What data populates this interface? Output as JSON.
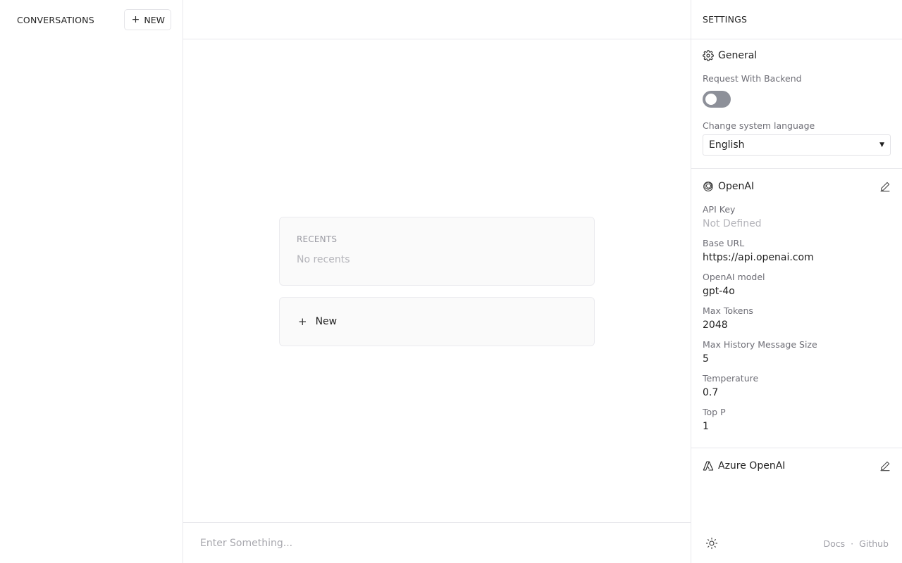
{
  "sidebar": {
    "title": "Conversations",
    "new_label": "New"
  },
  "main": {
    "recents_label": "Recents",
    "recents_empty": "No recents",
    "new_label": "New",
    "input_placeholder": "Enter Something..."
  },
  "settings": {
    "title": "Settings",
    "general": {
      "title": "General",
      "request_backend_label": "Request With Backend",
      "request_backend_on": false,
      "language_label": "Change system language",
      "language_value": "English"
    },
    "openai": {
      "title": "OpenAI",
      "fields": [
        {
          "label": "API Key",
          "value": "Not Defined"
        },
        {
          "label": "Base URL",
          "value": "https://api.openai.com"
        },
        {
          "label": "OpenAI model",
          "value": "gpt-4o"
        },
        {
          "label": "Max Tokens",
          "value": "2048"
        },
        {
          "label": "Max History Message Size",
          "value": "5"
        },
        {
          "label": "Temperature",
          "value": "0.7"
        },
        {
          "label": "Top P",
          "value": "1"
        }
      ]
    },
    "azure": {
      "title": "Azure OpenAI"
    },
    "footer": {
      "docs": "Docs",
      "separator": "·",
      "github": "Github"
    }
  },
  "icons": {
    "gear": "gear-icon",
    "openai": "openai-logo-icon",
    "azure": "azure-logo-icon",
    "edit": "pencil-icon",
    "theme": "sun-icon",
    "plus": "plus-icon",
    "caret": "caret-down-icon"
  }
}
